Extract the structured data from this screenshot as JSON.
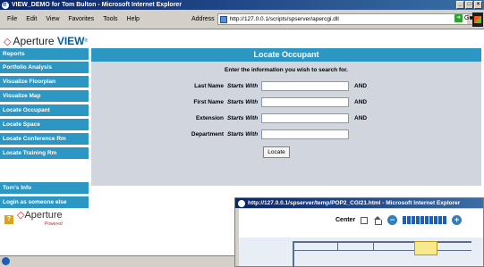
{
  "window": {
    "title": "VIEW_DEMO for Tom Bulton - Microsoft Internet Explorer",
    "controls": [
      "_",
      "□",
      "×"
    ]
  },
  "menu": [
    "File",
    "Edit",
    "View",
    "Favorites",
    "Tools",
    "Help"
  ],
  "address": {
    "label": "Address",
    "url": "http://127.0.0.1/scripts/spserver/apercgi.dll",
    "go_label": "Go"
  },
  "logo": {
    "brand": "Aperture",
    "product": "VIEW",
    "mark": "®"
  },
  "sidebar": {
    "items": [
      "Reports",
      "Portfolio Analysis",
      "Visualize Floorplan",
      "Visualize Map",
      "Locate Occupant",
      "Locate Space",
      "Locate Conference Rm",
      "Locate Training Rm"
    ],
    "bottom_items": [
      "Tom's Info",
      "Login as someone else"
    ],
    "powered": {
      "brand": "Aperture",
      "sub": "Powered"
    }
  },
  "main": {
    "heading": "Locate Occupant",
    "intro": "Enter the information you wish to search for.",
    "fields": [
      {
        "label": "Last Name",
        "op": "Starts With",
        "value": "",
        "conj": "AND"
      },
      {
        "label": "First Name",
        "op": "Starts With",
        "value": "",
        "conj": "AND"
      },
      {
        "label": "Extension",
        "op": "Starts With",
        "value": "",
        "conj": "AND"
      },
      {
        "label": "Department",
        "op": "Starts With",
        "value": "",
        "conj": ""
      }
    ],
    "button": "Locate"
  },
  "popup": {
    "title": "http://127.0.0.1/spserver/temp/POP2_CGI21.html - Microsoft Internet Explorer",
    "center_label": "Center"
  },
  "colors": {
    "accent": "#2d97c4",
    "panel": "#d1d6de",
    "titlebar": "#0a246a",
    "brand_red": "#d2232a"
  }
}
